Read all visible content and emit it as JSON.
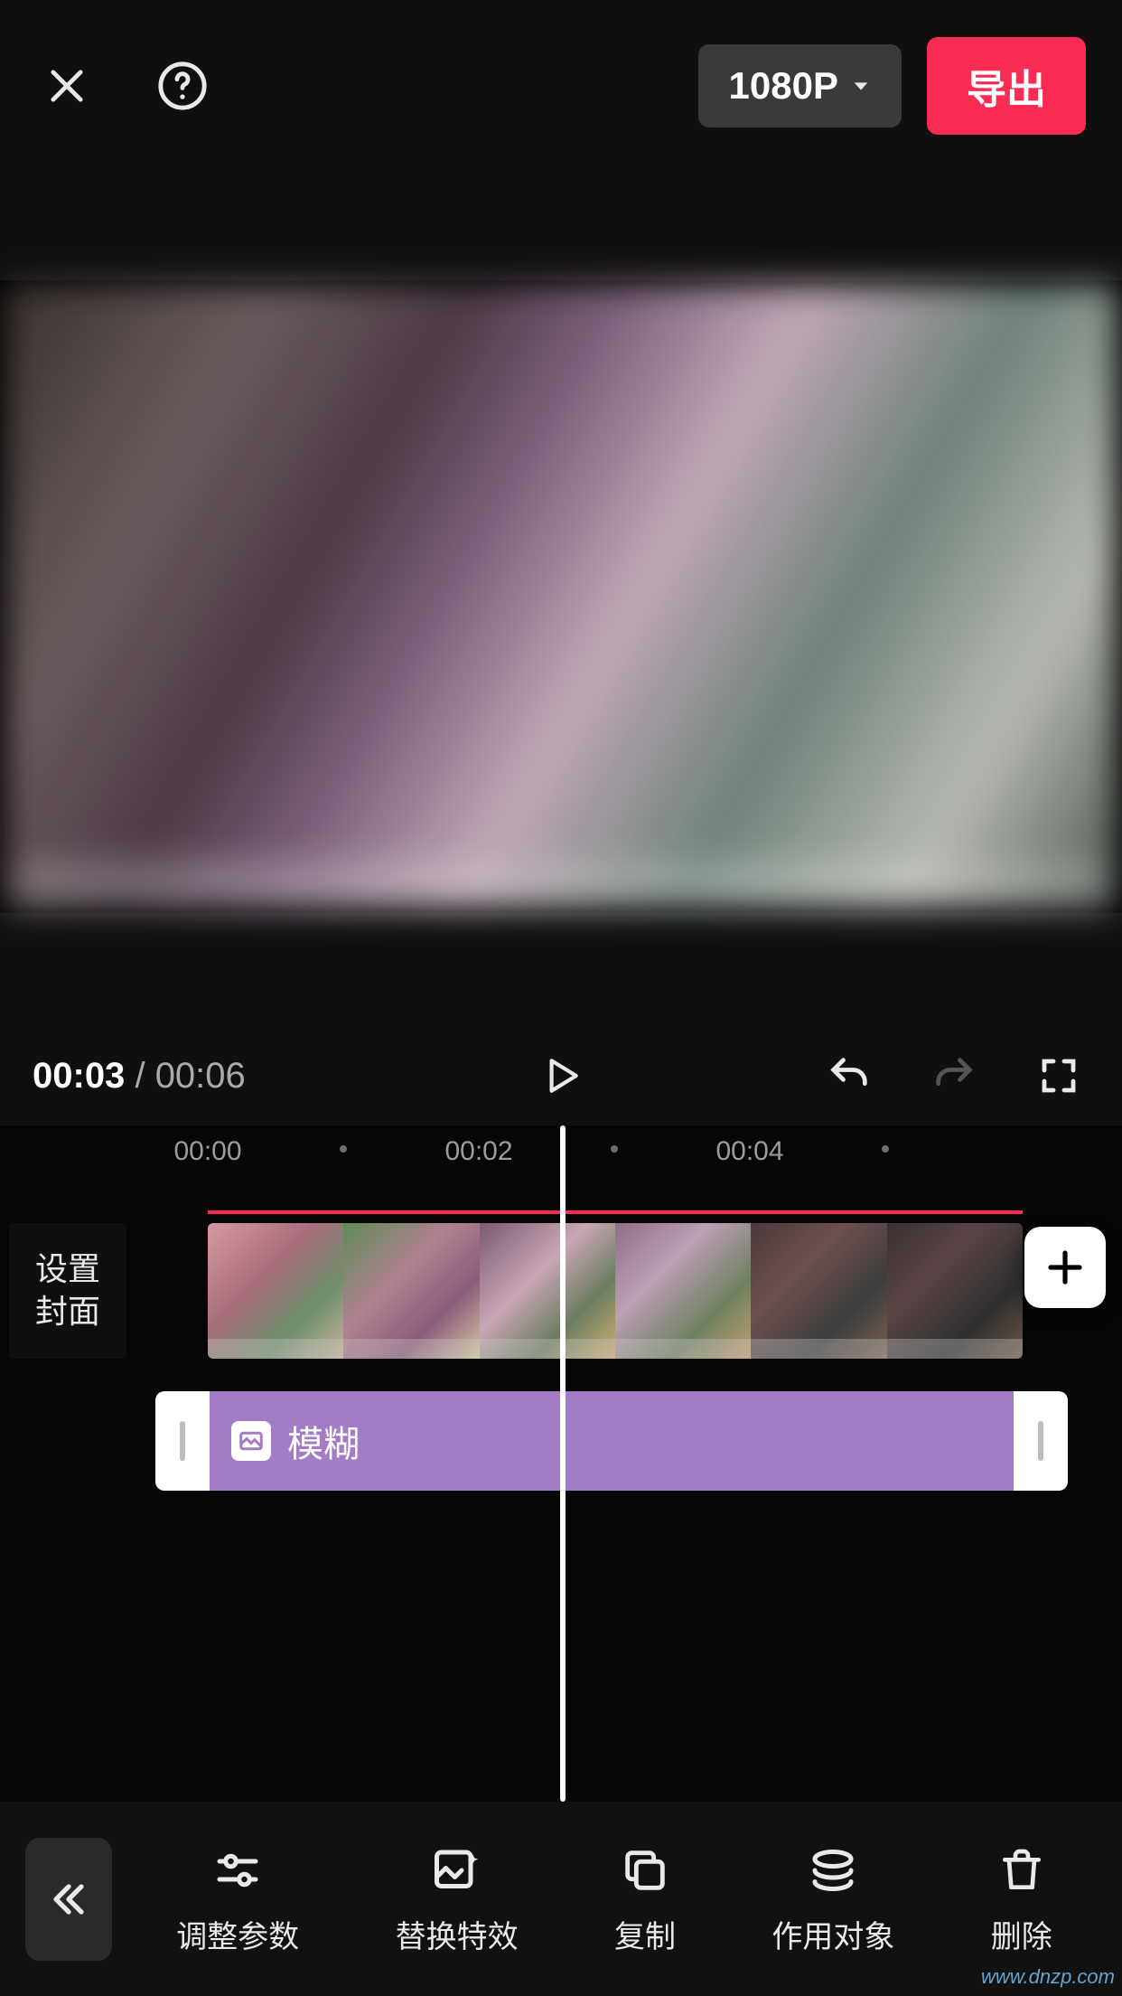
{
  "header": {
    "resolution_label": "1080P",
    "export_label": "导出"
  },
  "playback": {
    "current_time": "00:03",
    "separator": "/",
    "total_time": "00:06"
  },
  "ruler": {
    "ticks": [
      "00:00",
      "00:02",
      "00:04"
    ]
  },
  "tracks": {
    "cover_button_label": "设置\n封面",
    "effect": {
      "label": "模糊"
    }
  },
  "toolbar": {
    "items": [
      {
        "id": "params",
        "label": "调整参数"
      },
      {
        "id": "replace",
        "label": "替换特效"
      },
      {
        "id": "copy",
        "label": "复制"
      },
      {
        "id": "target",
        "label": "作用对象"
      },
      {
        "id": "delete",
        "label": "删除"
      }
    ]
  },
  "watermark": "www.dnzp.com"
}
